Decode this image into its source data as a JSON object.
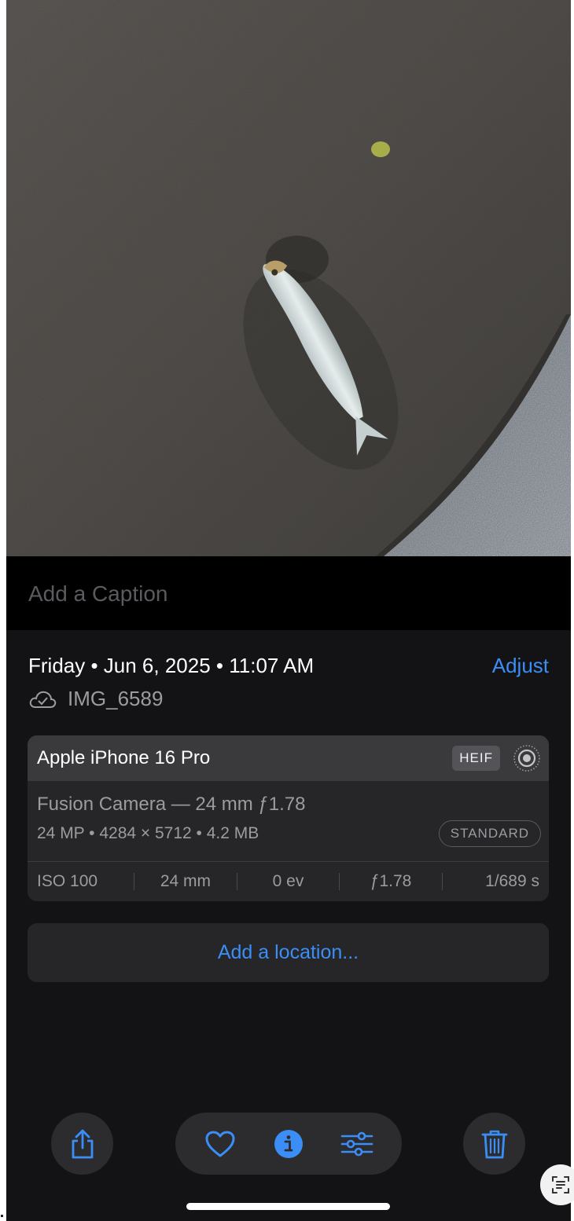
{
  "photo": {
    "subject": "fish-on-rock-photo"
  },
  "caption": {
    "placeholder": "Add a Caption",
    "value": ""
  },
  "info": {
    "date_text": "Friday • Jun 6, 2025 • 11:07 AM",
    "adjust_label": "Adjust",
    "filename": "IMG_6589",
    "cloud_icon": "icloud-check-icon"
  },
  "exif": {
    "device": "Apple iPhone 16 Pro",
    "format_badge": "HEIF",
    "live_icon": "live-photo-icon",
    "lens": "Fusion Camera — 24 mm ƒ1.78",
    "specs": "24 MP • 4284 × 5712 • 4.2 MB",
    "style_badge": "STANDARD",
    "row": {
      "iso": "ISO 100",
      "focal": "24 mm",
      "ev": "0 ev",
      "aperture": "ƒ1.78",
      "shutter": "1/689 s"
    }
  },
  "location": {
    "label": "Add a location..."
  },
  "toolbar": {
    "share_icon": "share-icon",
    "favorite_icon": "heart-icon",
    "info_icon": "info-icon",
    "edit_icon": "adjust-sliders-icon",
    "delete_icon": "trash-icon"
  },
  "colors": {
    "accent": "#3a8ef6",
    "background": "#131315",
    "card": "#262629"
  }
}
